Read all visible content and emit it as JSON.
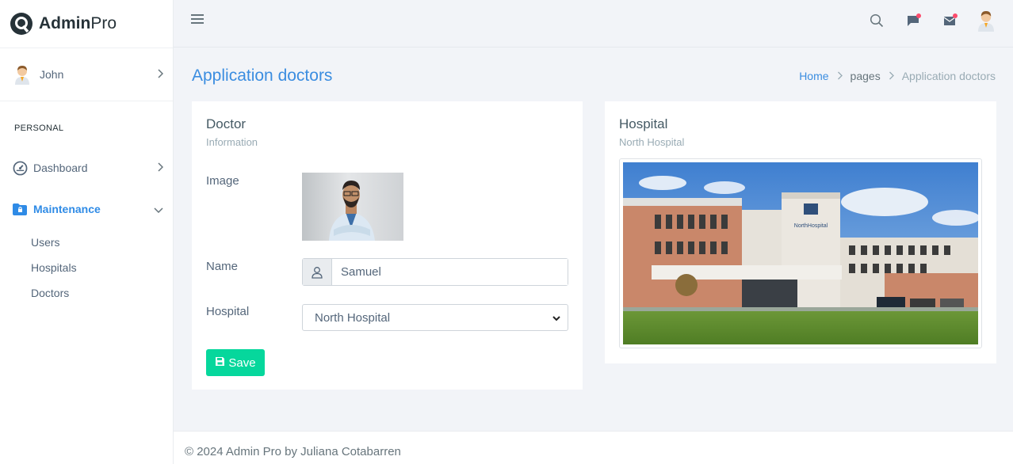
{
  "brand": {
    "name_bold": "Admin",
    "name_light": "Pro"
  },
  "sidebar": {
    "user_name": "John",
    "section": "PERSONAL",
    "items": [
      {
        "label": "Dashboard",
        "icon": "gauge-icon"
      },
      {
        "label": "Maintenance",
        "icon": "folder-lock-icon"
      }
    ],
    "subitems": [
      "Users",
      "Hospitals",
      "Doctors"
    ]
  },
  "header": {
    "page_title": "Application doctors",
    "breadcrumb": [
      "Home",
      "pages",
      "Application doctors"
    ]
  },
  "doctor_card": {
    "title": "Doctor",
    "subtitle": "Information",
    "image_label": "Image",
    "name_label": "Name",
    "name_value": "Samuel",
    "hospital_label": "Hospital",
    "hospital_value": "North Hospital",
    "save_label": "Save"
  },
  "hospital_card": {
    "title": "Hospital",
    "subtitle": "North Hospital"
  },
  "footer": {
    "text": "© 2024 Admin Pro by Juliana Cotabarren"
  },
  "colors": {
    "accent": "#3b8de0",
    "success": "#06d79c",
    "badge": "#fc4b6c"
  }
}
